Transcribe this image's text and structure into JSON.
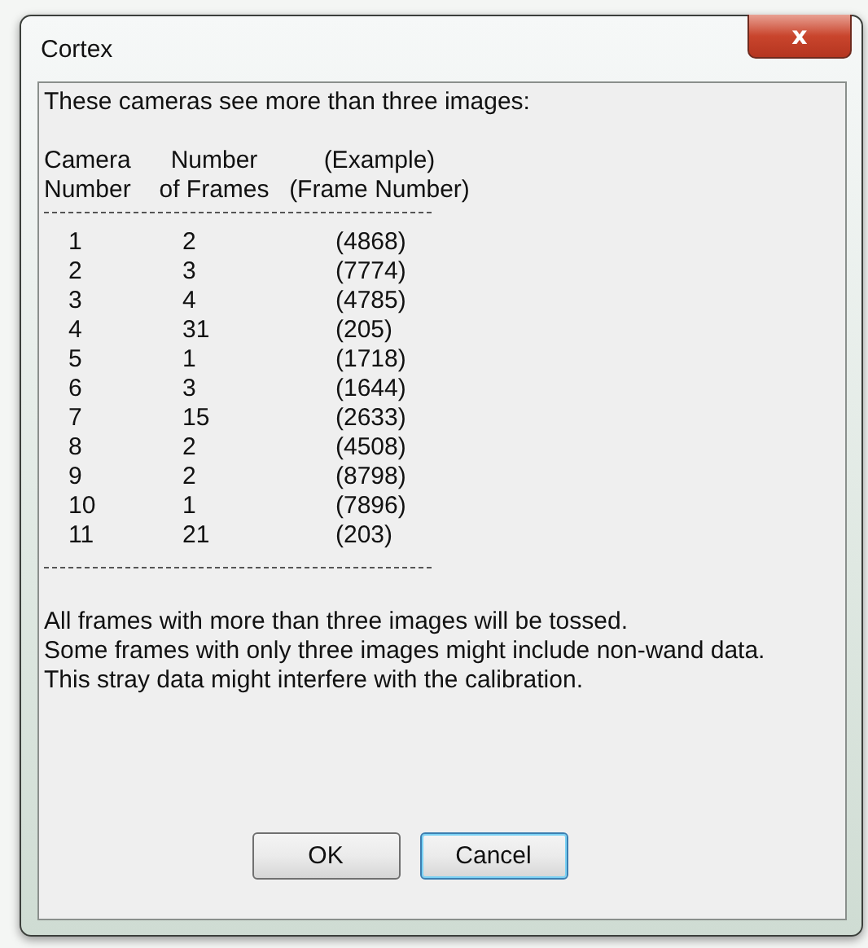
{
  "window": {
    "title": "Cortex",
    "close_glyph": "x"
  },
  "message": "These cameras see more than three images:",
  "table": {
    "header_rows": [
      [
        "Camera",
        "Number",
        "(Example)"
      ],
      [
        "Number",
        "of Frames",
        "(Frame Number)"
      ]
    ],
    "rows": [
      [
        "1",
        "2",
        "(4868)"
      ],
      [
        "2",
        "3",
        "(7774)"
      ],
      [
        "3",
        "4",
        "(4785)"
      ],
      [
        "4",
        "31",
        "(205)"
      ],
      [
        "5",
        "1",
        "(1718)"
      ],
      [
        "6",
        "3",
        "(1644)"
      ],
      [
        "7",
        "15",
        "(2633)"
      ],
      [
        "8",
        "2",
        "(4508)"
      ],
      [
        "9",
        "2",
        "(8798)"
      ],
      [
        "10",
        "1",
        "(7896)"
      ],
      [
        "11",
        "21",
        "(203)"
      ]
    ]
  },
  "notes": [
    "All frames with more than three images will be tossed.",
    "Some frames with only three images might include non-wand data.",
    "This stray data might interfere with the calibration."
  ],
  "buttons": [
    {
      "label": "OK",
      "focused": false
    },
    {
      "label": "Cancel",
      "focused": true
    }
  ]
}
